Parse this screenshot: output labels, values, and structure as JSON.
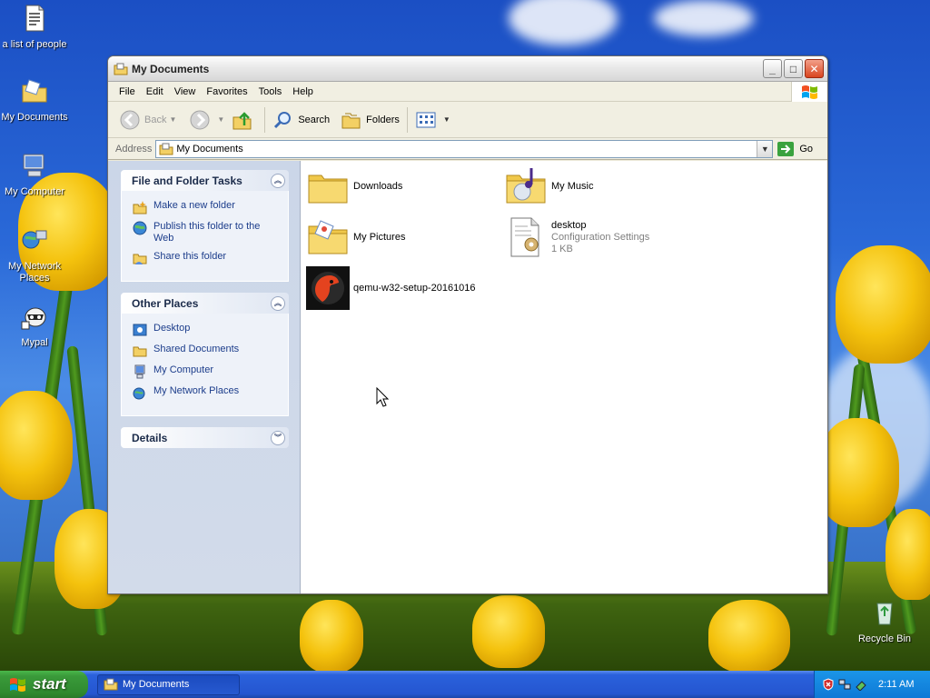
{
  "desktop": {
    "icons": [
      {
        "label": "a list of people"
      },
      {
        "label": "My Documents"
      },
      {
        "label": "My Computer"
      },
      {
        "label": "My Network Places"
      },
      {
        "label": "Mypal"
      },
      {
        "label": "Recycle Bin"
      }
    ]
  },
  "window": {
    "title": "My Documents",
    "controls": {
      "minimize": "_",
      "maximize": "□",
      "close": "✕"
    },
    "menu": [
      "File",
      "Edit",
      "View",
      "Favorites",
      "Tools",
      "Help"
    ],
    "toolbar": {
      "back": "Back",
      "search": "Search",
      "folders": "Folders"
    },
    "address": {
      "label": "Address",
      "value": "My Documents",
      "go": "Go"
    }
  },
  "sidepanel": {
    "file_tasks": {
      "title": "File and Folder Tasks",
      "items": [
        "Make a new folder",
        "Publish this folder to the Web",
        "Share this folder"
      ]
    },
    "other_places": {
      "title": "Other Places",
      "items": [
        "Desktop",
        "Shared Documents",
        "My Computer",
        "My Network Places"
      ]
    },
    "details": {
      "title": "Details"
    }
  },
  "files": [
    {
      "name": "Downloads"
    },
    {
      "name": "My Music"
    },
    {
      "name": "My Pictures"
    },
    {
      "name": "desktop",
      "type": "Configuration Settings",
      "size": "1 KB"
    },
    {
      "name": "qemu-w32-setup-20161016"
    }
  ],
  "taskbar": {
    "start": "start",
    "task": "My Documents",
    "clock": "2:11 AM"
  },
  "colors": {
    "link": "#1c3d8b",
    "taskbar": "#2556d0",
    "start": "#3a9a3a"
  }
}
